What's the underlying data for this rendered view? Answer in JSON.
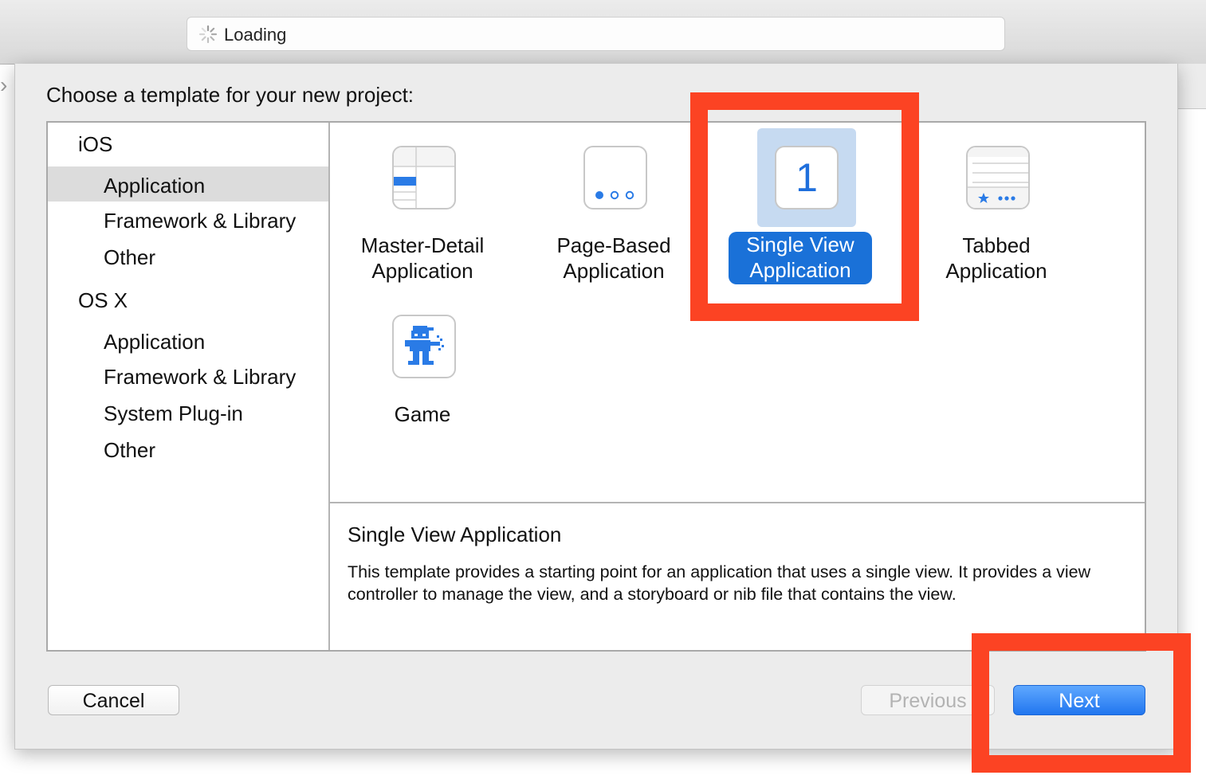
{
  "toolbar": {
    "activity_text": "Loading"
  },
  "sheet": {
    "title": "Choose a template for your new project:"
  },
  "sidebar": {
    "sections": [
      {
        "label": "iOS",
        "items": [
          "Application",
          "Framework & Library",
          "Other"
        ]
      },
      {
        "label": "OS X",
        "items": [
          "Application",
          "Framework & Library",
          "System Plug-in",
          "Other"
        ]
      }
    ],
    "selected": "iOS / Application"
  },
  "templates": [
    {
      "line1": "Master-Detail",
      "line2": "Application",
      "icon": "master-detail-icon"
    },
    {
      "line1": "Page-Based",
      "line2": "Application",
      "icon": "page-based-icon"
    },
    {
      "line1": "Single View",
      "line2": "Application",
      "icon": "single-view-icon",
      "icon_glyph": "1",
      "selected": true
    },
    {
      "line1": "Tabbed",
      "line2": "Application",
      "icon": "tabbed-icon"
    },
    {
      "line1": "Game",
      "icon": "game-icon"
    }
  ],
  "description": {
    "title": "Single View Application",
    "body": "This template provides a starting point for an application that uses a single view. It provides a view controller to manage the view, and a storyboard or nib file that contains the view."
  },
  "buttons": {
    "cancel": "Cancel",
    "previous": "Previous",
    "next": "Next"
  },
  "colors": {
    "accent": "#1a71d8",
    "highlight": "#fc4323",
    "selection_bg": "#c6daf1",
    "icon_blue": "#2a7be6"
  }
}
